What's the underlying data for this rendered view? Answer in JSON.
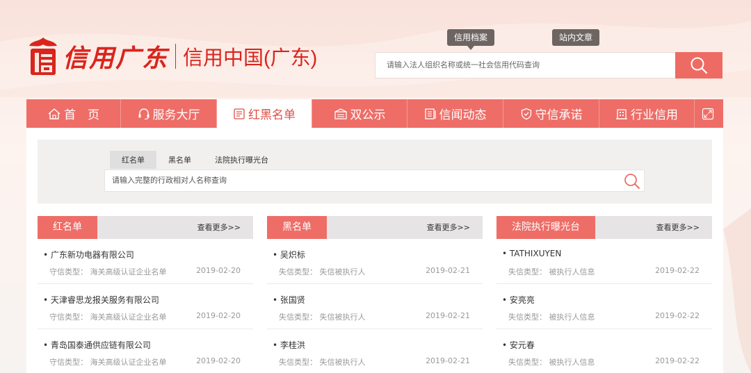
{
  "header": {
    "logo_script": "信用广东",
    "logo_subtitle": "信用中国(广东)",
    "search_tabs": [
      "信用档案",
      "站内文章"
    ],
    "search_placeholder": "请输入法人组织名称或统一社会信用代码查询"
  },
  "nav": {
    "items": [
      {
        "label": "首　页",
        "icon": "home-icon"
      },
      {
        "label": "服务大厅",
        "icon": "headset-icon"
      },
      {
        "label": "红黑名单",
        "icon": "list-icon"
      },
      {
        "label": "双公示",
        "icon": "inbox-icon"
      },
      {
        "label": "信闻动态",
        "icon": "news-icon"
      },
      {
        "label": "守信承诺",
        "icon": "shield-icon"
      },
      {
        "label": "行业信用",
        "icon": "building-icon"
      }
    ],
    "active_index": 2
  },
  "list_search": {
    "tabs": [
      "红名单",
      "黑名单",
      "法院执行曝光台"
    ],
    "active_tab": 0,
    "placeholder": "请输入完整的行政相对人名称查询"
  },
  "columns": [
    {
      "title": "红名单",
      "more": "查看更多>>",
      "items": [
        {
          "name": "广东新功电器有限公司",
          "type_label": "守信类型：",
          "type": "海关高级认证企业名单",
          "date": "2019-02-20"
        },
        {
          "name": "天津睿思龙报关服务有限公司",
          "type_label": "守信类型：",
          "type": "海关高级认证企业名单",
          "date": "2019-02-20"
        },
        {
          "name": "青岛国泰通供应链有限公司",
          "type_label": "守信类型：",
          "type": "海关高级认证企业名单",
          "date": "2019-02-20"
        }
      ]
    },
    {
      "title": "黑名单",
      "more": "查看更多>>",
      "items": [
        {
          "name": "吴炽标",
          "type_label": "失信类型：",
          "type": "失信被执行人",
          "date": "2019-02-21"
        },
        {
          "name": "张国贤",
          "type_label": "失信类型：",
          "type": "失信被执行人",
          "date": "2019-02-21"
        },
        {
          "name": "李桂洪",
          "type_label": "失信类型：",
          "type": "失信被执行人",
          "date": "2019-02-21"
        }
      ]
    },
    {
      "title": "法院执行曝光台",
      "more": "查看更多>>",
      "items": [
        {
          "name": "TATHIXUYEN",
          "type_label": "失信类型：",
          "type": "被执行人信息",
          "date": "2019-02-22"
        },
        {
          "name": "安亮亮",
          "type_label": "失信类型：",
          "type": "被执行人信息",
          "date": "2019-02-22"
        },
        {
          "name": "安元春",
          "type_label": "失信类型：",
          "type": "被执行人信息",
          "date": "2019-02-22"
        }
      ]
    }
  ],
  "colors": {
    "accent": "#ee6d67",
    "brand_red": "#d9251c",
    "dark_tab": "#6d6562"
  }
}
